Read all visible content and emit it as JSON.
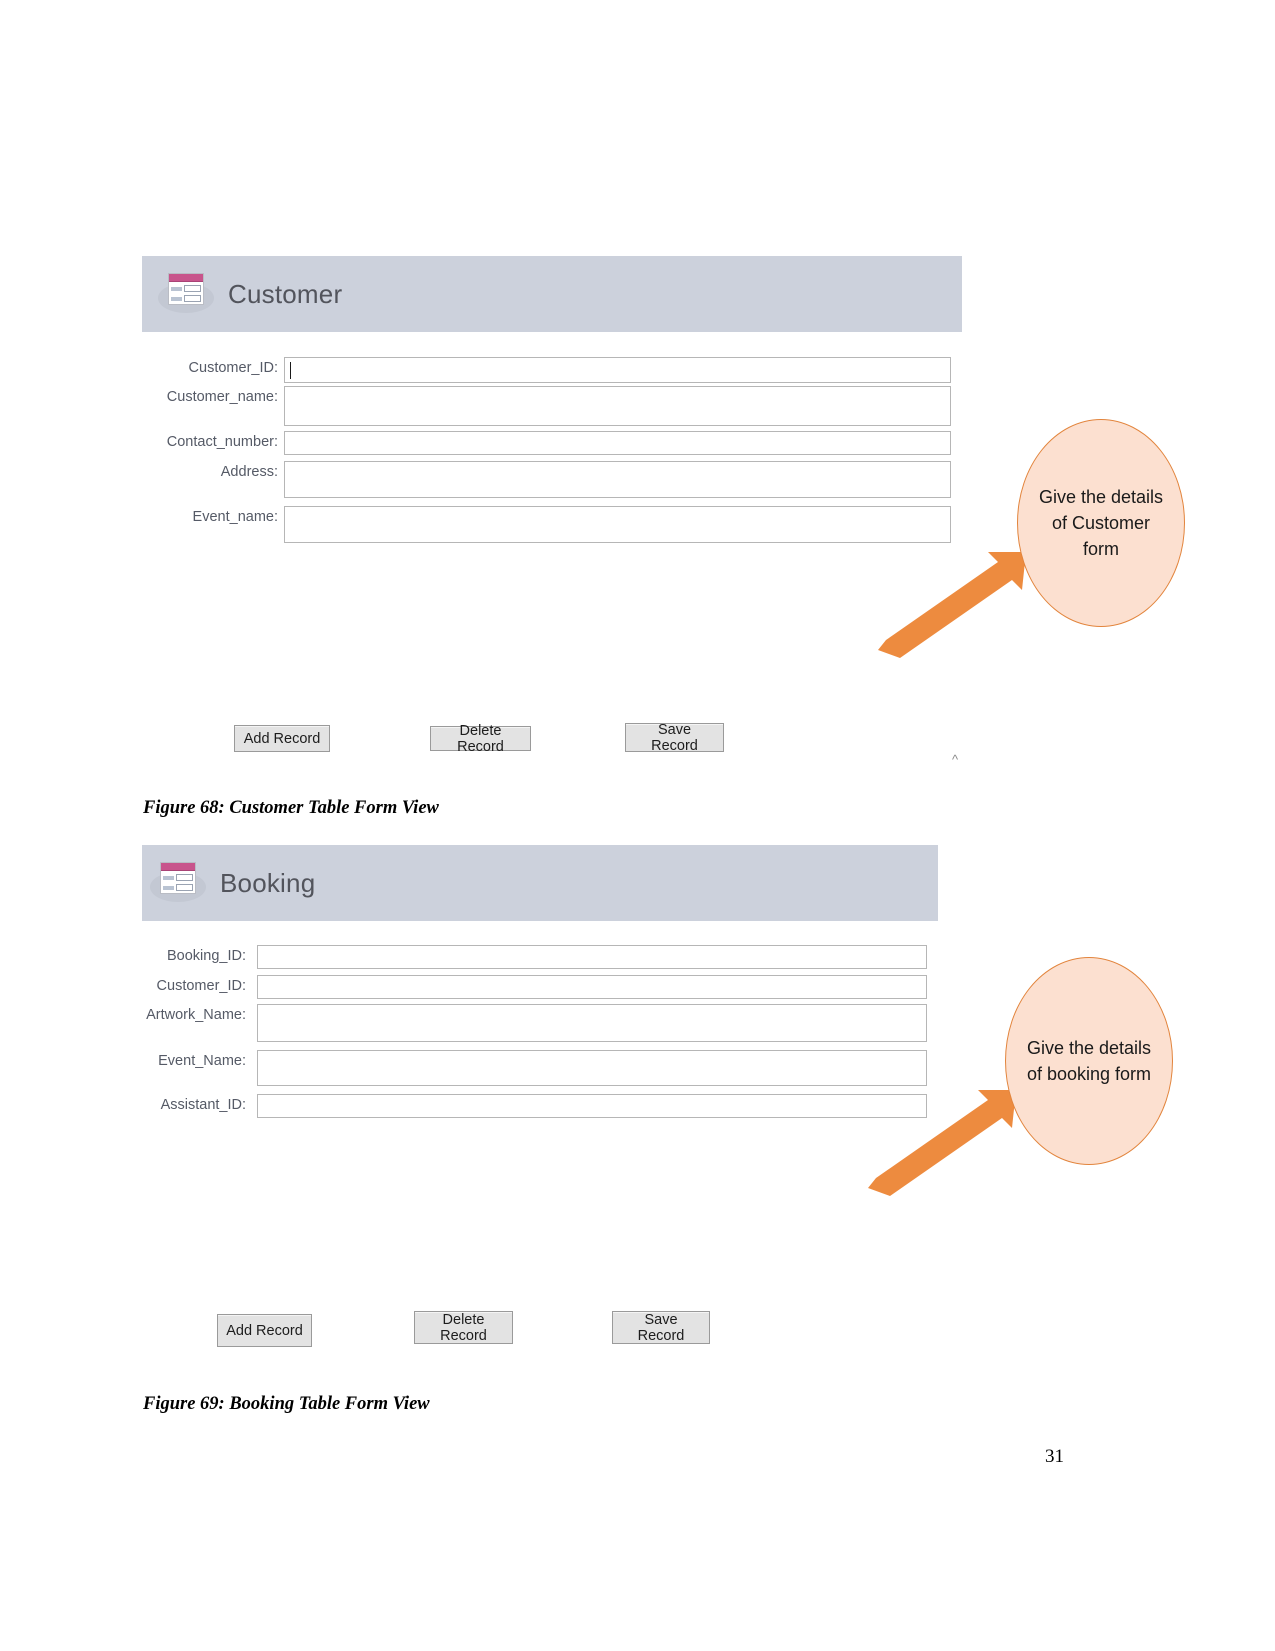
{
  "document": {
    "page_number": "31",
    "stray_mark": "^"
  },
  "figures": [
    {
      "form": {
        "title": "Customer",
        "icon": "access-form-icon",
        "fields": [
          {
            "label": "Customer_ID:",
            "value": "",
            "focused": true
          },
          {
            "label": "Customer_name:",
            "value": "",
            "focused": false
          },
          {
            "label": "Contact_number:",
            "value": "",
            "focused": false
          },
          {
            "label": "Address:",
            "value": "",
            "focused": false
          },
          {
            "label": "Event_name:",
            "value": "",
            "focused": false
          }
        ],
        "buttons": [
          {
            "label": "Add Record"
          },
          {
            "label": "Delete Record"
          },
          {
            "label": "Save Record"
          }
        ]
      },
      "callout": {
        "text": "Give the details of Customer form",
        "fill_color": "#fce0d0",
        "border_color": "#e2843c",
        "arrow_color": "#ed8b3f"
      },
      "caption": "Figure 68: Customer Table Form View"
    },
    {
      "form": {
        "title": "Booking",
        "icon": "access-form-icon",
        "fields": [
          {
            "label": "Booking_ID:",
            "value": "",
            "focused": false
          },
          {
            "label": "Customer_ID:",
            "value": "",
            "focused": false
          },
          {
            "label": "Artwork_Name:",
            "value": "",
            "focused": false
          },
          {
            "label": "Event_Name:",
            "value": "",
            "focused": false
          },
          {
            "label": "Assistant_ID:",
            "value": "",
            "focused": false
          }
        ],
        "buttons": [
          {
            "label": "Add Record"
          },
          {
            "label": "Delete Record"
          },
          {
            "label": "Save Record"
          }
        ]
      },
      "callout": {
        "text": "Give the details of booking form",
        "fill_color": "#fce0d0",
        "border_color": "#e2843c",
        "arrow_color": "#ed8b3f"
      },
      "caption": "Figure 69: Booking Table Form View"
    }
  ]
}
